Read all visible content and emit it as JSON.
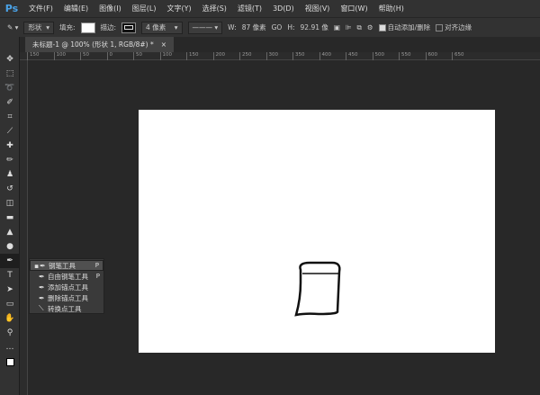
{
  "app": {
    "logo": "Ps"
  },
  "menu": [
    "文件(F)",
    "编辑(E)",
    "图像(I)",
    "图层(L)",
    "文字(Y)",
    "选择(S)",
    "滤镜(T)",
    "3D(D)",
    "视图(V)",
    "窗口(W)",
    "帮助(H)"
  ],
  "options": {
    "mode": "形状",
    "fill_label": "填充:",
    "stroke_label": "描边:",
    "stroke_width": "4 像素",
    "w_label": "W:",
    "w_value": "87 像素",
    "link": "GO",
    "h_label": "H:",
    "h_value": "92.91 像",
    "auto_add": "自动添加/删除",
    "auto_add_checked": true,
    "align_edges": "对齐边缘",
    "align_edges_checked": false
  },
  "tab": {
    "title": "未标题-1 @ 100% (形状 1, RGB/8#) *",
    "close": "×"
  },
  "ruler": [
    "150",
    "100",
    "50",
    "0",
    "50",
    "100",
    "150",
    "200",
    "250",
    "300",
    "350",
    "400",
    "450",
    "500",
    "550",
    "600",
    "650"
  ],
  "flyout": [
    {
      "label": "钢笔工具",
      "key": "P",
      "selected": true
    },
    {
      "label": "自由钢笔工具",
      "key": "P"
    },
    {
      "label": "添加锚点工具",
      "key": ""
    },
    {
      "label": "删除锚点工具",
      "key": ""
    },
    {
      "label": "转换点工具",
      "key": ""
    }
  ]
}
